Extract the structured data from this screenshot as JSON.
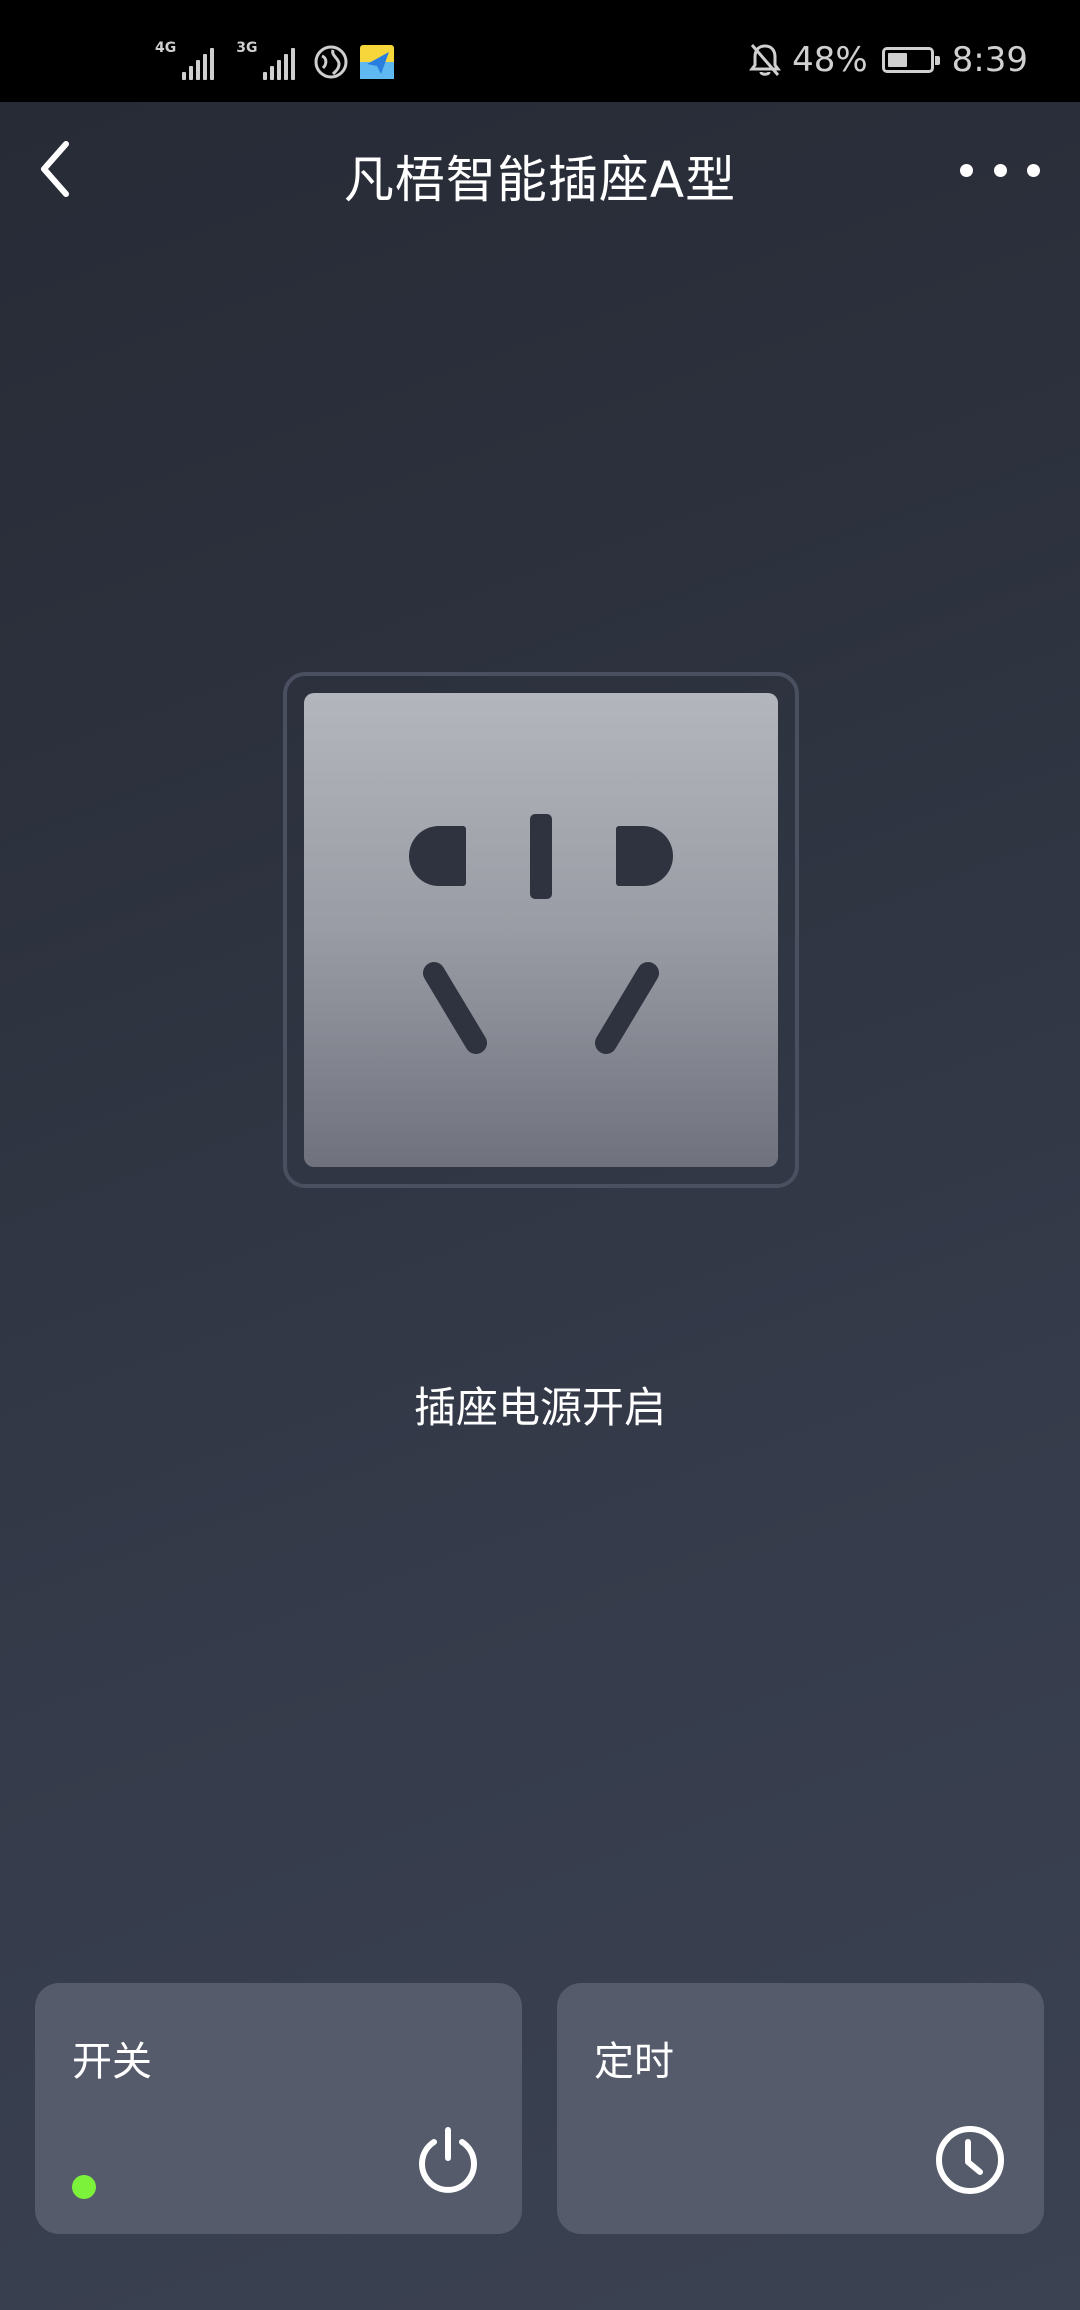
{
  "status_bar": {
    "net1": "4G",
    "net2": "3G",
    "battery_percent": "48%",
    "battery_level": 0.48,
    "time": "8:39",
    "icons": [
      "signal-4g-icon",
      "signal-3g-icon",
      "browser-icon",
      "map-app-icon",
      "bell-off-icon",
      "battery-icon"
    ]
  },
  "header": {
    "title": "凡梧智能插座A型",
    "back_icon": "chevron-left-icon",
    "more_icon": "more-dots-icon"
  },
  "main": {
    "socket_icon": "power-socket-icon",
    "status_text": "插座电源开启"
  },
  "cards": {
    "switch": {
      "label": "开关",
      "icon": "power-icon",
      "indicator_color": "#7cf23a",
      "on": true
    },
    "timer": {
      "label": "定时",
      "icon": "clock-icon"
    }
  },
  "colors": {
    "background": "#2c313d",
    "card": "#555b6b",
    "socket_hole": "#2f3340"
  }
}
